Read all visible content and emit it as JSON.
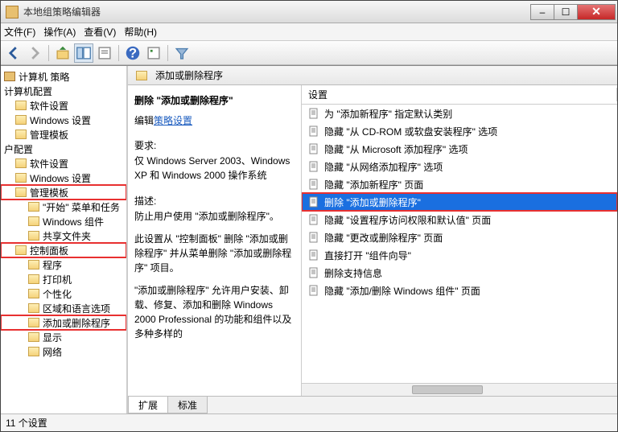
{
  "window": {
    "title": "本地组策略编辑器"
  },
  "menubar": {
    "file": "文件(F)",
    "action": "操作(A)",
    "view": "查看(V)",
    "help": "帮助(H)"
  },
  "tree": {
    "root": "计算机 策略",
    "computer_config": "计算机配置",
    "cc_software": "软件设置",
    "cc_windows": "Windows 设置",
    "cc_templates": "管理模板",
    "user_config": "户配置",
    "uc_software": "软件设置",
    "uc_windows": "Windows 设置",
    "uc_templates": "管理模板",
    "start_menu": "\"开始\" 菜单和任务",
    "win_components": "Windows 组件",
    "shared_folders": "共享文件夹",
    "control_panel": "控制面板",
    "programs": "程序",
    "printers": "打印机",
    "personalization": "个性化",
    "region_lang": "区域和语言选项",
    "add_remove": "添加或删除程序",
    "display": "显示",
    "network": "网络"
  },
  "path_header": "添加或删除程序",
  "desc": {
    "title": "删除 \"添加或删除程序\"",
    "edit_label": "编辑",
    "edit_link": "策略设置",
    "req_label": "要求:",
    "req_text": "仅 Windows Server 2003、Windows XP 和 Windows 2000 操作系统",
    "desc_label": "描述:",
    "desc_text1": "防止用户使用 \"添加或删除程序\"。",
    "desc_text2": "此设置从 \"控制面板\" 删除 \"添加或删除程序\" 并从菜单删除 \"添加或删除程序\" 项目。",
    "desc_text3": "\"添加或删除程序\" 允许用户安装、卸载、修复、添加和删除 Windows 2000 Professional 的功能和组件以及多种多样的"
  },
  "list": {
    "header": "设置",
    "items": [
      "为 \"添加新程序\" 指定默认类别",
      "隐藏 \"从 CD-ROM 或软盘安装程序\" 选项",
      "隐藏 \"从 Microsoft 添加程序\" 选项",
      "隐藏 \"从网络添加程序\" 选项",
      "隐藏 \"添加新程序\" 页面",
      "删除 \"添加或删除程序\"",
      "隐藏 \"设置程序访问权限和默认值\" 页面",
      "隐藏 \"更改或删除程序\" 页面",
      "直接打开 \"组件向导\"",
      "删除支持信息",
      "隐藏 \"添加/删除 Windows 组件\" 页面"
    ],
    "selected_index": 5
  },
  "tabs": {
    "extended": "扩展",
    "standard": "标准"
  },
  "status": "11 个设置",
  "win_controls": {
    "min": "–",
    "max": "☐",
    "close": "✕"
  }
}
